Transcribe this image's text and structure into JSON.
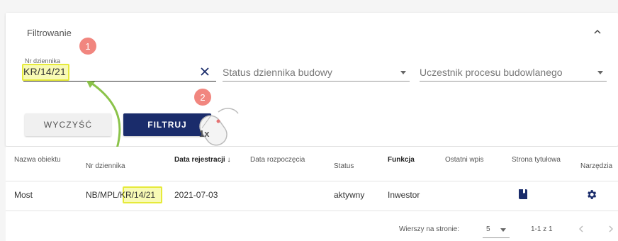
{
  "filter": {
    "title": "Filtrowanie",
    "journal_number_label": "Nr dziennika",
    "journal_number_value": "KR/14/21",
    "status_placeholder": "Status dziennika budowy",
    "participant_placeholder": "Uczestnik procesu budowlanego",
    "clear_button": "WYCZYŚĆ",
    "filter_button": "FILTRUJ"
  },
  "annotations": {
    "step1": "1",
    "step2": "2",
    "click_count": "1x",
    "highlight_color": "#e6ea3a",
    "arrow_color": "#8bc34a"
  },
  "table": {
    "headers": [
      "Nazwa obiektu",
      "Nr dziennika",
      "Data rejestracji ↓",
      "Data rozpoczęcia",
      "Status",
      "Funkcja",
      "Ostatni wpis",
      "Strona tytułowa",
      "Narzędzia"
    ],
    "rows": [
      {
        "name": "Most",
        "journal_prefix": "NB/MPL/",
        "journal_highlight": "KR/14/21",
        "registration_date": "2021-07-03",
        "start_date": "",
        "status": "aktywny",
        "function": "Inwestor",
        "last_entry": ""
      }
    ]
  },
  "pagination": {
    "rows_per_page_label": "Wierszy na stronie:",
    "rows_per_page_value": "5",
    "range": "1-1 z 1"
  },
  "colors": {
    "primary": "#1a2c6b",
    "step_badge": "#f07a72"
  }
}
